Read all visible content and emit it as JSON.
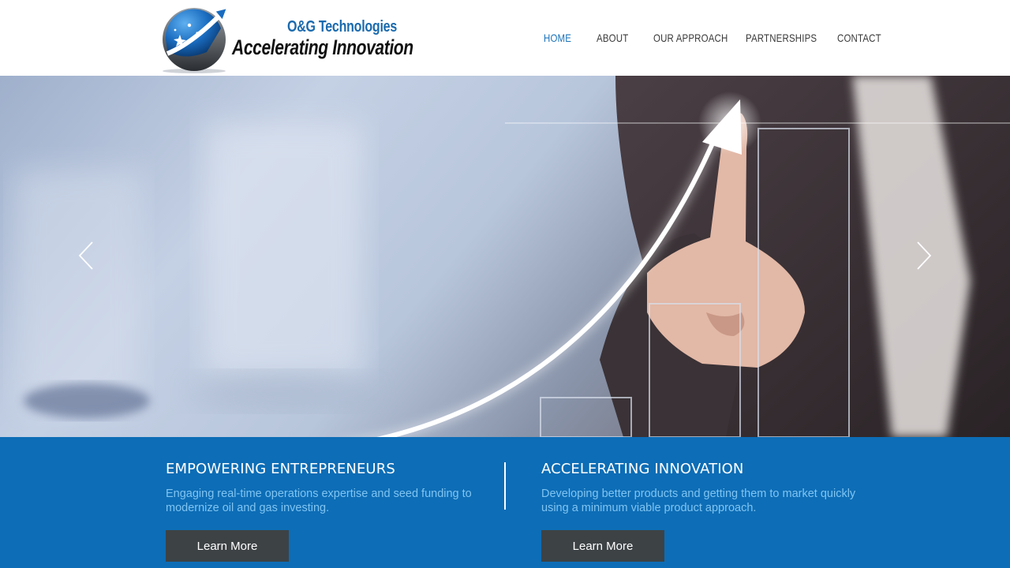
{
  "logo": {
    "company": "O&G Technologies",
    "tagline": "Accelerating Innovation"
  },
  "nav": {
    "items": [
      {
        "label": "HOME",
        "active": true
      },
      {
        "label": "ABOUT"
      },
      {
        "label": "OUR APPROACH"
      },
      {
        "label": "PARTNERSHIPS"
      },
      {
        "label": "CONTACT"
      }
    ]
  },
  "slideshow": {
    "prev_icon": "chevron-left-icon",
    "next_icon": "chevron-right-icon"
  },
  "features": [
    {
      "title": "EMPOWERING ENTREPRENEURS",
      "text": "Engaging real-time operations expertise and seed funding to modernize oil and gas investing.",
      "button": "Learn More"
    },
    {
      "title": "ACCELERATING INNOVATION",
      "text": "Developing better products and getting them to market quickly using a minimum viable product approach.",
      "button": "Learn More"
    }
  ],
  "colors": {
    "band": "#0d6db6",
    "nav_active": "#1a72b8",
    "button": "#3d4245",
    "body_text_on_band": "#7fc4f2"
  }
}
